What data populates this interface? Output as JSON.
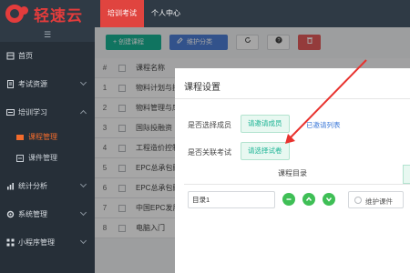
{
  "app": {
    "logo_text": "轻速云"
  },
  "topnav": [
    {
      "label": "培训考试"
    },
    {
      "label": "个人中心"
    }
  ],
  "sidebar": {
    "toggle": "☰",
    "items": [
      {
        "label": "首页"
      },
      {
        "label": "考试资源"
      },
      {
        "label": "培训学习"
      },
      {
        "label": "课程管理"
      },
      {
        "label": "课件管理"
      },
      {
        "label": "统计分析"
      },
      {
        "label": "系统管理"
      },
      {
        "label": "小程序管理"
      }
    ]
  },
  "toolbar": {
    "create_label": "+ 创建课程",
    "category_label": "维护分类"
  },
  "table": {
    "header_num": "#",
    "header_name": "课程名称",
    "rows": [
      {
        "num": "1",
        "name": "物料计划与控制"
      },
      {
        "num": "2",
        "name": "物料管理与库存"
      },
      {
        "num": "3",
        "name": "国际投融资"
      },
      {
        "num": "4",
        "name": "工程造价控制"
      },
      {
        "num": "5",
        "name": "EPC总承包融资"
      },
      {
        "num": "6",
        "name": "EPC总承包融资"
      },
      {
        "num": "7",
        "name": "中国EPC发展"
      },
      {
        "num": "8",
        "name": "电脑入门"
      }
    ]
  },
  "modal": {
    "title": "课程设置",
    "select_members_label": "是否选择成员",
    "select_members_button": "请邀请成员",
    "invite_list_link": "已邀请列表",
    "link_exam_label": "是否关联考试",
    "select_exam_button": "请选择试卷",
    "catalog_title": "课程目录",
    "directory_value": "目录1",
    "maintain_courseware_label": "维护课件"
  },
  "colors": {
    "brand": "#e33c3c",
    "nav_active": "#e0443f",
    "sidebar_bg": "#262f38",
    "accent_green": "#1ab394",
    "annotation_arrow": "#e8322e"
  }
}
